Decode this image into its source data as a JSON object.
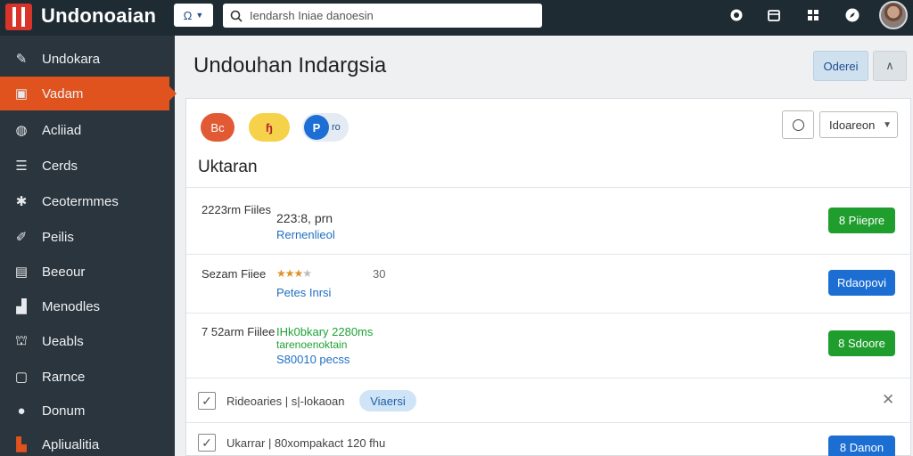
{
  "app": {
    "brand": "Undonoaian"
  },
  "topbar": {
    "scope_label": "Ω",
    "search_placeholder": "Iendarsh Iniae danoesin",
    "icons": [
      "help-icon",
      "calendar-icon",
      "apps-icon",
      "compass-icon"
    ]
  },
  "sidebar": {
    "items": [
      {
        "label": "Undokara",
        "icon": "pin-icon",
        "active": false
      },
      {
        "label": "Vadam",
        "icon": "archive-icon",
        "active": true
      },
      {
        "label": "Acliiad",
        "icon": "globe-icon",
        "active": false
      },
      {
        "label": "Cerds",
        "icon": "list-icon",
        "active": false
      },
      {
        "label": "Ceotermmes",
        "icon": "gear-icon",
        "active": false
      },
      {
        "label": "Peilis",
        "icon": "pen-icon",
        "active": false
      },
      {
        "label": "Beeour",
        "icon": "document-icon",
        "active": false
      },
      {
        "label": "Menodles",
        "icon": "bar-chart-icon",
        "active": false
      },
      {
        "label": "Ueabls",
        "icon": "lock-icon",
        "active": false
      },
      {
        "label": "Rarnce",
        "icon": "monitor-icon",
        "active": false
      },
      {
        "label": "Donum",
        "icon": "user-icon",
        "active": false
      },
      {
        "label": "Apliualitia",
        "icon": "chart-icon",
        "active": false
      }
    ]
  },
  "header": {
    "title": "Undouhan Indargsia",
    "primary_button": "Oderei",
    "collapse_icon": "chevron-up-icon"
  },
  "panel": {
    "chips": [
      {
        "label": "Bc"
      },
      {
        "label": "ɧ"
      },
      {
        "avatar": "P",
        "label": "ro"
      }
    ],
    "select_value": "Idoareon",
    "section_title": "Uktaran",
    "rows": [
      {
        "label": "2223rm Fiiles",
        "main": "223:8, prn",
        "sub": "Rernenlieol",
        "action": "8 Piiepre"
      },
      {
        "label": "Sezam Fiiee",
        "rating": 3,
        "rating_max": 4,
        "number": "30",
        "sub": "Petes Inrsi",
        "action": "Rdaopovi"
      },
      {
        "label": "7 52arm Fiilee",
        "main": "IHk0bkary 2280ms",
        "main2": "tarenoenoktain",
        "sub": "S80010 pecss",
        "action": "8 Sdoore"
      }
    ],
    "footer_rows": [
      {
        "text": "Rideoaries | s|-lokaoan",
        "badge": "Viaersi",
        "checked": true
      },
      {
        "text": "Ukarrar | 80xompakact 120 fhu",
        "action": "8 Danon",
        "checked": true
      }
    ]
  }
}
